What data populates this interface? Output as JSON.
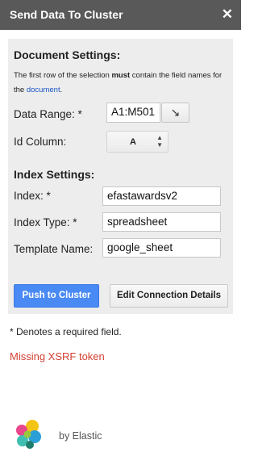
{
  "titlebar": {
    "title": "Send Data To Cluster",
    "close_label": "✕"
  },
  "document_settings": {
    "heading": "Document Settings:",
    "desc_part1": "The first row of the selection ",
    "desc_bold": "must",
    "desc_part2": " contain the field names for the ",
    "desc_link": "document",
    "desc_end": ".",
    "data_range_label": "Data Range: *",
    "data_range_value": "A1:M501",
    "range_button_label": "↘",
    "id_column_label": "Id Column:",
    "id_column_value": "A"
  },
  "index_settings": {
    "heading": "Index Settings:",
    "index_label": "Index: *",
    "index_value": "efastawardsv2",
    "index_type_label": "Index Type: *",
    "index_type_value": "spreadsheet",
    "template_label": "Template Name:",
    "template_value": "google_sheet"
  },
  "actions": {
    "push_label": "Push to Cluster",
    "edit_label": "Edit Connection Details"
  },
  "footer": {
    "required_note": "* Denotes a required field.",
    "error_message": "Missing XSRF token",
    "by_text": "by Elastic"
  },
  "colors": {
    "titlebar_bg": "#595959",
    "primary_button": "#4a8af4",
    "error_text": "#d23f31",
    "link": "#1a55c5"
  }
}
